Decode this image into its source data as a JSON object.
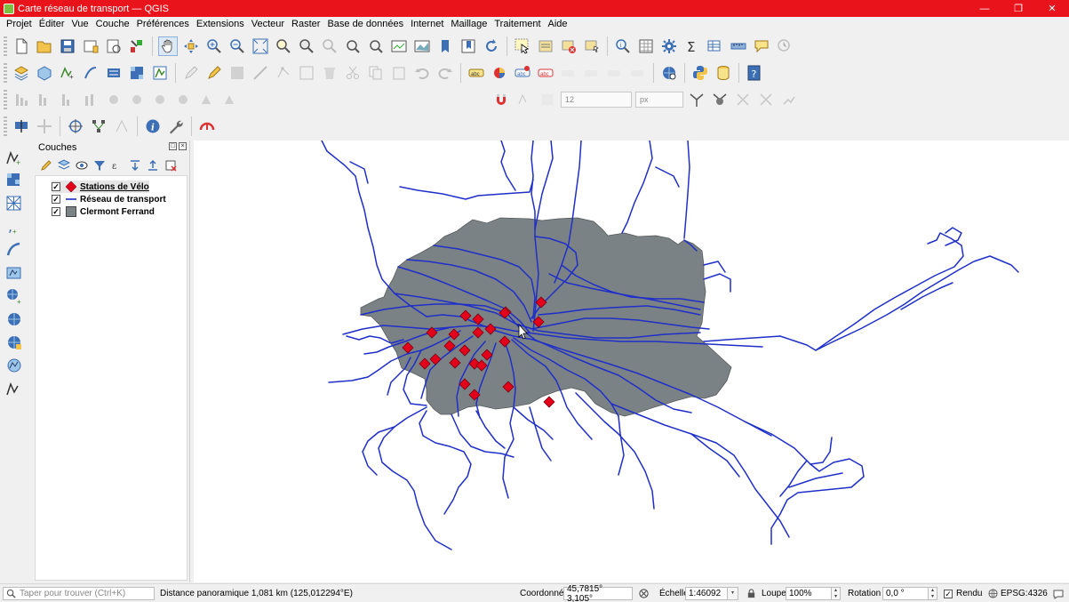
{
  "window": {
    "title": "Carte réseau de transport — QGIS",
    "controls": {
      "minimize": "—",
      "maximize": "❐",
      "close": "✕"
    }
  },
  "menu": [
    "Projet",
    "Éditer",
    "Vue",
    "Couche",
    "Préférences",
    "Extensions",
    "Vecteur",
    "Raster",
    "Base de données",
    "Internet",
    "Maillage",
    "Traitement",
    "Aide"
  ],
  "toolbar_snapping": {
    "tolerance_value": "12",
    "tolerance_unit": "px"
  },
  "layers_panel": {
    "title": "Couches",
    "layers": [
      {
        "name": "Stations de Vélo",
        "checked": true,
        "symbol": "red-diamond",
        "color": "#e3001b"
      },
      {
        "name": "Réseau de transport",
        "checked": true,
        "symbol": "blue-line",
        "color": "#1f2fc8"
      },
      {
        "name": "Clermont Ferrand",
        "checked": true,
        "symbol": "gray-fill",
        "color": "#7b8285"
      }
    ]
  },
  "map": {
    "polygon_fill": "#7b8285",
    "line_color": "#1f2fc8",
    "station_color": "#e3001b",
    "station_count": 24
  },
  "status": {
    "locator_placeholder": "Taper pour trouver (Ctrl+K)",
    "message": "Distance panoramique 1,081 km (125,012294°E)",
    "coordinate_label": "Coordonnée",
    "coordinate_value": "45,7815° 3,105°",
    "scale_label": "Échelle",
    "scale_value": "1:46092",
    "magnifier_label": "Loupe",
    "magnifier_value": "100%",
    "rotation_label": "Rotation",
    "rotation_value": "0,0 °",
    "render_label": "Rendu",
    "render_checked": true,
    "crs": "EPSG:4326"
  }
}
